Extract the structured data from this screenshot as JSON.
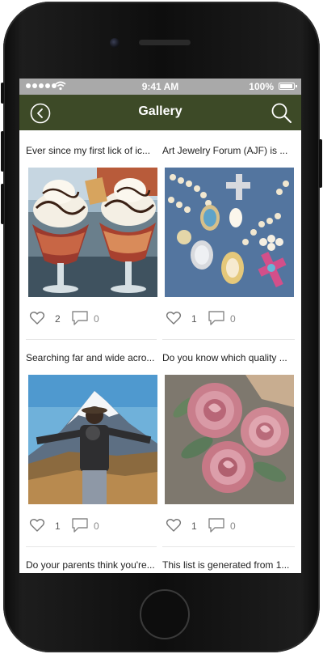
{
  "status_bar": {
    "time": "9:41 AM",
    "battery": "100%",
    "battery_level": 1.0
  },
  "app_bar": {
    "title": "Gallery",
    "back_icon": "back-circle-icon",
    "search_icon": "search-icon"
  },
  "posts": [
    {
      "caption": "Ever since my first lick of ic...",
      "image": "ice-cream-sundaes",
      "likes": "2",
      "comments": "0"
    },
    {
      "caption": "Art Jewelry Forum (AJF) is ...",
      "image": "pearl-jewelry-on-denim",
      "likes": "1",
      "comments": "0"
    },
    {
      "caption": "Searching far and wide acro...",
      "image": "hiker-facing-mountain",
      "likes": "1",
      "comments": "0"
    },
    {
      "caption": "Do you know which quality ...",
      "image": "pink-roses",
      "likes": "1",
      "comments": "0"
    },
    {
      "caption": "Do your parents think you're...",
      "image": "",
      "likes": "",
      "comments": ""
    },
    {
      "caption": "This list is generated from 1...",
      "image": "",
      "likes": "",
      "comments": ""
    }
  ],
  "colors": {
    "app_bar": "#3d4a27",
    "status_bar": "#a9a9a9",
    "phone_body": "#0e0e0e"
  }
}
